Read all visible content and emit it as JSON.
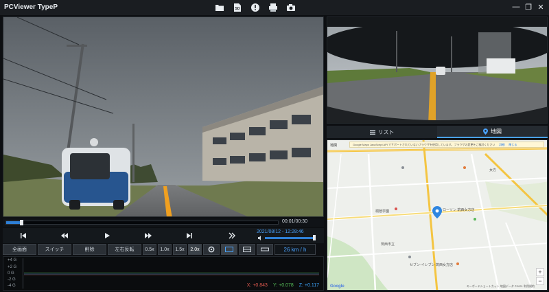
{
  "app": {
    "title": "PCViewer TypeP"
  },
  "toolbar": {
    "icons": [
      "folder-icon",
      "sd-card-icon",
      "alert-icon",
      "printer-icon",
      "camera-icon"
    ],
    "sd_label": "SD"
  },
  "window": {
    "minimize": "—",
    "restore": "❐",
    "close": "✕"
  },
  "player": {
    "time": "00:01/00:30",
    "datetime": "2021/08/12 - 12:28:46",
    "progress": 0.05,
    "volume": 0.95
  },
  "buttons": {
    "fullscreen": "全画面",
    "switch": "スイッチ",
    "delete": "削除",
    "mirror": "左右反転",
    "speeds": [
      "0.5x",
      "1.0x",
      "1.5x",
      "2.0x"
    ],
    "speed_value": "26 km / h"
  },
  "gsensor": {
    "labels": [
      "+4 G",
      "+2 G",
      "0 G",
      "-2 G",
      "-4 G"
    ],
    "x": "X: +0.843",
    "y": "Y: +0.078",
    "z": "Z: +0.117"
  },
  "tabs": {
    "list": "リスト",
    "map": "地図"
  },
  "map": {
    "tag": "地図",
    "banner": "Google Maps JavaScript API でサポートされていないブラウザを使用しています。ブラウザの変更をご検討ください",
    "banner_detail": "詳細",
    "banner_close": "閉じる",
    "footer": "キーボードショートカット 地図データ ©2021 利用規約",
    "google": "Google",
    "places": [
      "ローソン 筑西女方店",
      "女方",
      "桐蔭学園",
      "筑西市立",
      "セブン-イレブン 筑西女方店"
    ]
  },
  "colors": {
    "accent": "#2e7fd6",
    "highlight": "#4aa3ff",
    "x_value": "#e05a4f",
    "y_value": "#58c05a",
    "z_value": "#3da7ff"
  }
}
